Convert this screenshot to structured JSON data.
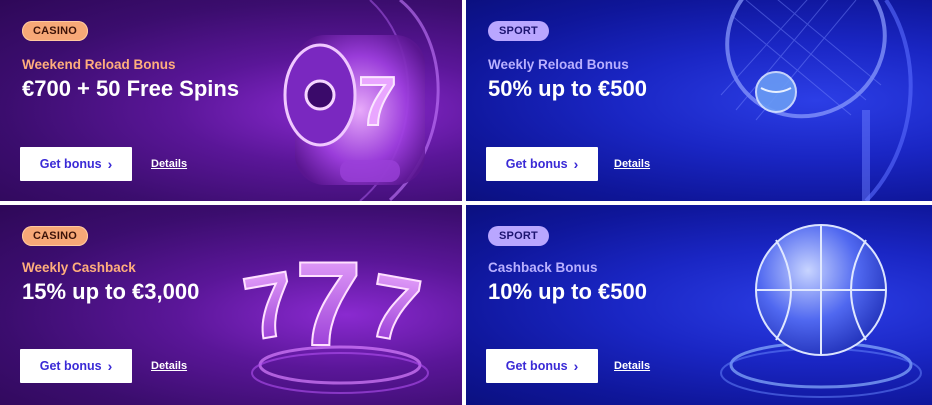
{
  "cards": [
    {
      "category": "CASINO",
      "subtitle": "Weekend Reload Bonus",
      "headline": "€700 + 50 Free Spins",
      "button": "Get bonus",
      "details": "Details",
      "art_icon": "slot-reel-icon"
    },
    {
      "category": "SPORT",
      "subtitle": "Weekly Reload Bonus",
      "headline": "50% up to €500",
      "button": "Get bonus",
      "details": "Details",
      "art_icon": "tennis-racket-icon"
    },
    {
      "category": "CASINO",
      "subtitle": "Weekly Cashback",
      "headline": "15% up to €3,000",
      "button": "Get bonus",
      "details": "Details",
      "art_icon": "lucky-777-icon"
    },
    {
      "category": "SPORT",
      "subtitle": "Cashback Bonus",
      "headline": "10% up to €500",
      "button": "Get bonus",
      "details": "Details",
      "art_icon": "basketball-icon"
    }
  ],
  "colors": {
    "casino_bg": "#4a1284",
    "sport_bg": "#1722b8",
    "casino_badge": "#f7a877",
    "sport_badge": "#b9a6ff",
    "button_text": "#3a2ad6"
  }
}
